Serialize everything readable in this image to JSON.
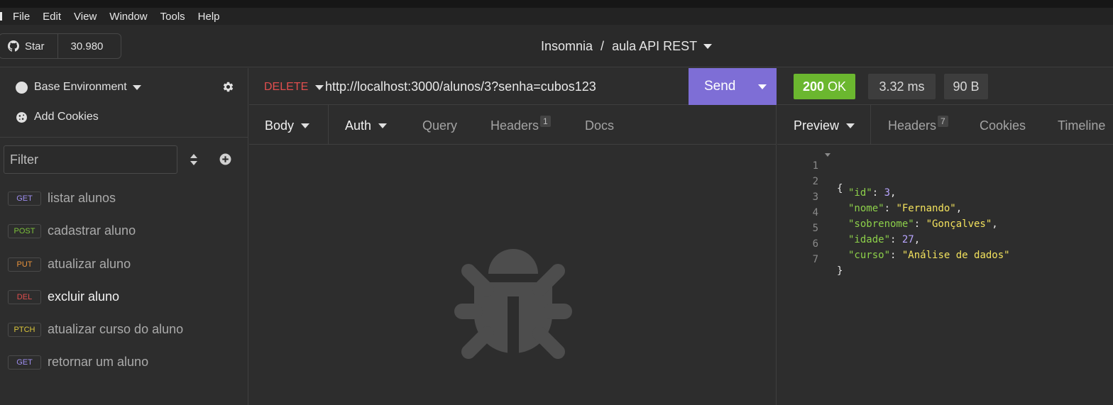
{
  "menu": [
    "File",
    "Edit",
    "View",
    "Window",
    "Tools",
    "Help"
  ],
  "github": {
    "star_label": "Star",
    "star_count": "30.980"
  },
  "breadcrumb": {
    "app": "Insomnia",
    "separator": "/",
    "workspace": "aula API REST"
  },
  "sidebar": {
    "environment": "Base Environment",
    "cookies": "Add Cookies",
    "filter_placeholder": "Filter",
    "requests": [
      {
        "method": "GET",
        "name": "listar alunos",
        "color": "#9e8ef0"
      },
      {
        "method": "POST",
        "name": "cadastrar aluno",
        "color": "#7cc13b"
      },
      {
        "method": "PUT",
        "name": "atualizar aluno",
        "color": "#e8923c"
      },
      {
        "method": "DEL",
        "name": "excluir aluno",
        "color": "#e04e4e"
      },
      {
        "method": "PTCH",
        "name": "atualizar curso do aluno",
        "color": "#dbc63c"
      },
      {
        "method": "GET",
        "name": "retornar um aluno",
        "color": "#9e8ef0"
      }
    ]
  },
  "request": {
    "method": "DELETE",
    "url": "http://localhost:3000/alunos/3?senha=cubos123",
    "send_label": "Send",
    "tabs": {
      "body": "Body",
      "auth": "Auth",
      "query": "Query",
      "headers": "Headers",
      "headers_count": "1",
      "docs": "Docs"
    }
  },
  "response": {
    "status_code": "200",
    "status_text": "OK",
    "time": "3.32 ms",
    "size": "90 B",
    "tabs": {
      "preview": "Preview",
      "headers": "Headers",
      "headers_count": "7",
      "cookies": "Cookies",
      "timeline": "Timeline"
    },
    "body_lines": [
      {
        "n": "1",
        "open": "{"
      },
      {
        "n": "2",
        "key": "\"id\"",
        "value": "3",
        "type": "num",
        "comma": ","
      },
      {
        "n": "3",
        "key": "\"nome\"",
        "value": "\"Fernando\"",
        "type": "str",
        "comma": ","
      },
      {
        "n": "4",
        "key": "\"sobrenome\"",
        "value": "\"Gonçalves\"",
        "type": "str",
        "comma": ","
      },
      {
        "n": "5",
        "key": "\"idade\"",
        "value": "27",
        "type": "num",
        "comma": ","
      },
      {
        "n": "6",
        "key": "\"curso\"",
        "value": "\"Análise de dados\"",
        "type": "str",
        "comma": ""
      },
      {
        "n": "7",
        "open": "}"
      }
    ]
  },
  "colors": {
    "send_button": "#7e6ed6",
    "status_ok": "#6bb72f",
    "delete_method": "#e04e4e"
  }
}
